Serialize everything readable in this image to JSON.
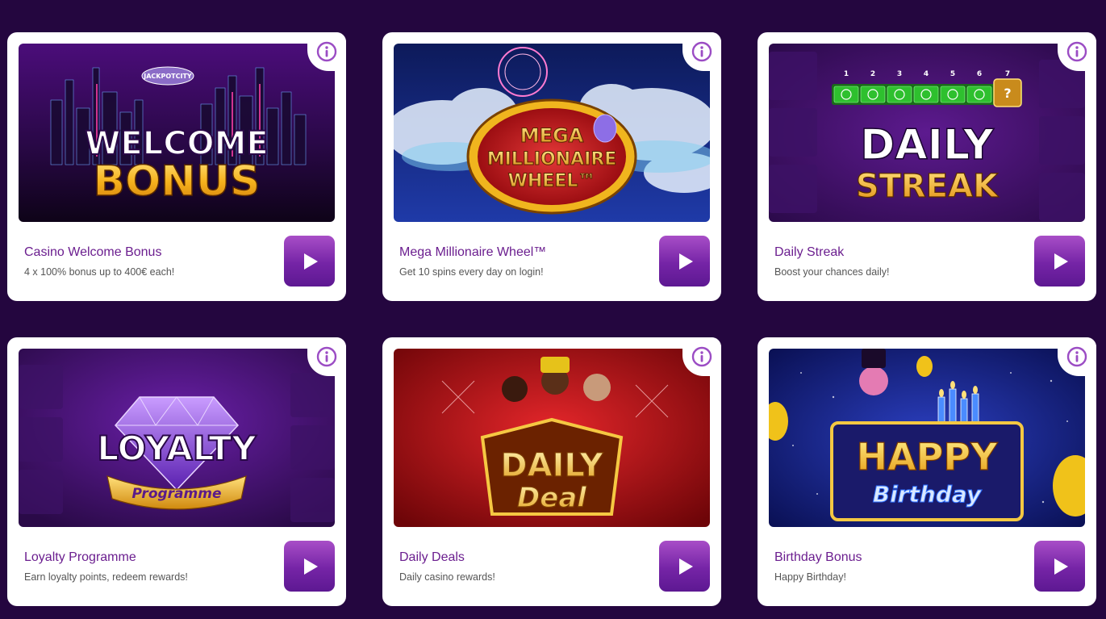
{
  "colors": {
    "page_background": "#24063f",
    "card_background": "#ffffff",
    "title_color": "#6b1e8f",
    "play_button": "#7524a6",
    "info_icon": "#9b4cc4"
  },
  "promotions": [
    {
      "title": "Casino Welcome Bonus",
      "subtitle": "4 x 100% bonus up to 400€ each!",
      "banner_line1": "WELCOME",
      "banner_line2": "BONUS",
      "badge": "JACKPOTCITY",
      "info_icon": "info-icon",
      "play_icon": "play-icon"
    },
    {
      "title": "Mega Millionaire Wheel™",
      "subtitle": "Get 10 spins every day on login!",
      "banner_line1": "MEGA",
      "banner_line2": "MILLIONAIRE",
      "banner_line3": "WHEEL™",
      "info_icon": "info-icon",
      "play_icon": "play-icon"
    },
    {
      "title": "Daily Streak",
      "subtitle": "Boost your chances daily!",
      "banner_line1": "DAILY",
      "banner_line2": "STREAK",
      "streak_days": [
        "1",
        "2",
        "3",
        "4",
        "5",
        "6",
        "7"
      ],
      "info_icon": "info-icon",
      "play_icon": "play-icon"
    },
    {
      "title": "Loyalty Programme",
      "subtitle": "Earn loyalty points, redeem rewards!",
      "banner_line1": "LOYALTY",
      "banner_line2": "Programme",
      "info_icon": "info-icon",
      "play_icon": "play-icon"
    },
    {
      "title": "Daily Deals",
      "subtitle": "Daily casino rewards!",
      "banner_line1": "DAILY",
      "banner_line2": "Deal",
      "info_icon": "info-icon",
      "play_icon": "play-icon"
    },
    {
      "title": "Birthday Bonus",
      "subtitle": "Happy Birthday!",
      "banner_line1": "HAPPY",
      "banner_line2": "Birthday",
      "info_icon": "info-icon",
      "play_icon": "play-icon"
    }
  ]
}
